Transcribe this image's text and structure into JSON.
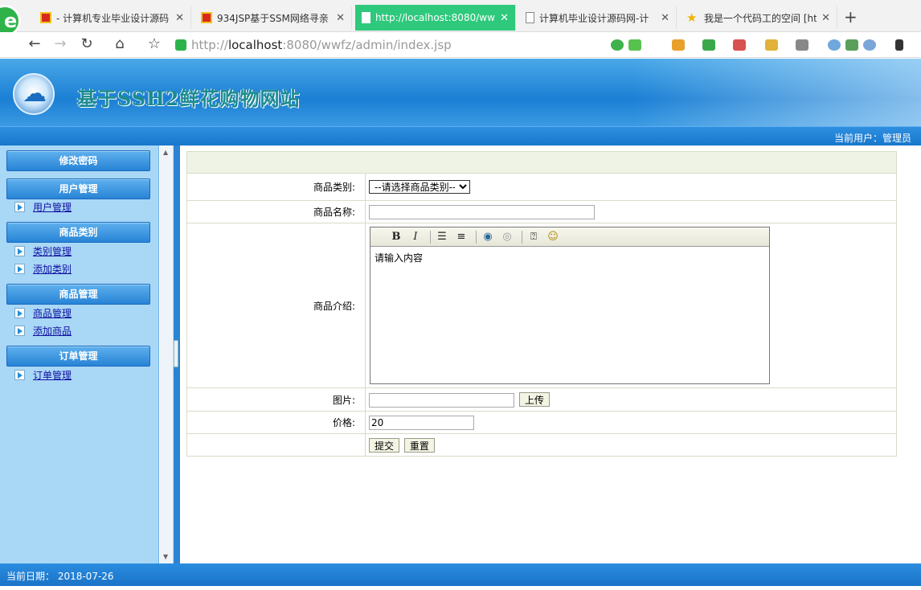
{
  "browser": {
    "tabs": [
      {
        "title": "- 计算机专业毕业设计源码",
        "active": false
      },
      {
        "title": "934JSP基于SSM网络寻亲",
        "active": false
      },
      {
        "title": "http://localhost:8080/ww",
        "active": true
      },
      {
        "title": "计算机毕业设计源码网-计",
        "active": false
      },
      {
        "title": "我是一个代码工的空间 [ht",
        "active": false
      }
    ],
    "address": {
      "prefix": "http://",
      "host": "localhost",
      "path": ":8080/wwfz/admin/index.jsp"
    }
  },
  "header": {
    "title": "基于SSH2鲜花购物网站",
    "current_user": "当前用户：管理员"
  },
  "sidebar": {
    "change_password": "修改密码",
    "sections": [
      {
        "title": "用户管理",
        "items": [
          "用户管理"
        ]
      },
      {
        "title": "商品类别",
        "items": [
          "类别管理",
          "添加类别"
        ]
      },
      {
        "title": "商品管理",
        "items": [
          "商品管理",
          "添加商品"
        ]
      },
      {
        "title": "订单管理",
        "items": [
          "订单管理"
        ]
      }
    ]
  },
  "form": {
    "category_label": "商品类别:",
    "category_selected": "--请选择商品类别--",
    "name_label": "商品名称:",
    "name_value": "",
    "intro_label": "商品介绍:",
    "intro_value": "请输入内容",
    "image_label": "图片:",
    "image_value": "",
    "upload_button": "上传",
    "price_label": "价格:",
    "price_value": "20",
    "submit_button": "提交",
    "reset_button": "重置"
  },
  "footer": {
    "date_text": "当前日期：  2018-07-26"
  }
}
